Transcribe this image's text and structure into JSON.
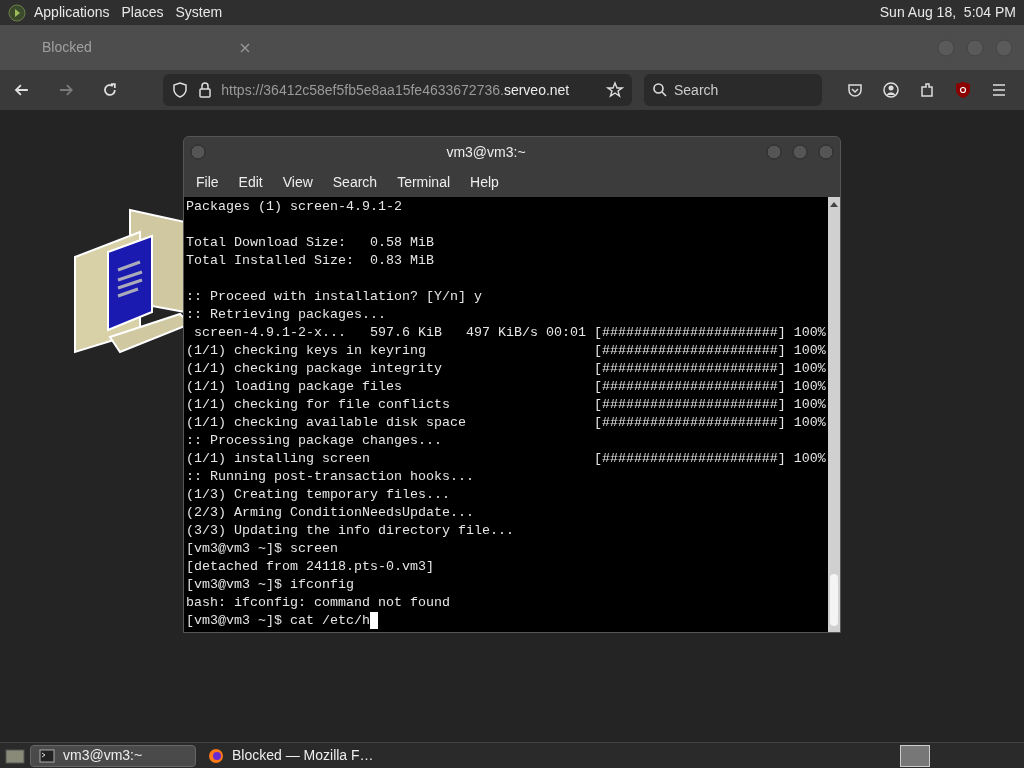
{
  "top_panel": {
    "menus": [
      "Applications",
      "Places",
      "System"
    ],
    "clock": "Sun Aug 18,  5:04 PM"
  },
  "browser": {
    "tab": {
      "title": "Blocked"
    },
    "url": {
      "prefix": "https://36412c58ef5fb5e8aa15fe4633672736.",
      "domain": "serveo.net"
    },
    "search": {
      "placeholder": "Search"
    }
  },
  "terminal": {
    "title": "vm3@vm3:~",
    "menus": [
      "File",
      "Edit",
      "View",
      "Search",
      "Terminal",
      "Help"
    ],
    "lines": [
      {
        "text": "Packages (1) screen-4.9.1-2"
      },
      {
        "text": "Total Download Size:   0.58 MiB",
        "blank_line_before": true
      },
      {
        "text": "Total Installed Size:  0.83 MiB"
      },
      {
        "text": ":: Proceed with installation? [Y/n] y",
        "blank_line_before": true
      },
      {
        "text": ":: Retrieving packages..."
      },
      {
        "text": " screen-4.9.1-2-x...   597.6 KiB   497 KiB/s 00:01",
        "progress": "[######################] 100%"
      },
      {
        "text": "(1/1) checking keys in keyring",
        "progress": "[######################] 100%"
      },
      {
        "text": "(1/1) checking package integrity",
        "progress": "[######################] 100%"
      },
      {
        "text": "(1/1) loading package files",
        "progress": "[######################] 100%"
      },
      {
        "text": "(1/1) checking for file conflicts",
        "progress": "[######################] 100%"
      },
      {
        "text": "(1/1) checking available disk space",
        "progress": "[######################] 100%"
      },
      {
        "text": ":: Processing package changes..."
      },
      {
        "text": "(1/1) installing screen",
        "progress": "[######################] 100%"
      },
      {
        "text": ":: Running post-transaction hooks..."
      },
      {
        "text": "(1/3) Creating temporary files..."
      },
      {
        "text": "(2/3) Arming ConditionNeedsUpdate..."
      },
      {
        "text": "(3/3) Updating the info directory file..."
      },
      {
        "text": "[vm3@vm3 ~]$ screen"
      },
      {
        "text": "[detached from 24118.pts-0.vm3]"
      },
      {
        "text": "[vm3@vm3 ~]$ ifconfig"
      },
      {
        "text": "bash: ifconfig: command not found"
      },
      {
        "text": "[vm3@vm3 ~]$ cat /etc/h",
        "cursor": true
      }
    ]
  },
  "taskbar": {
    "items": [
      {
        "label": "vm3@vm3:~",
        "selected": true,
        "kind": "terminal"
      },
      {
        "label": "Blocked — Mozilla F…",
        "selected": false,
        "kind": "firefox"
      }
    ]
  }
}
